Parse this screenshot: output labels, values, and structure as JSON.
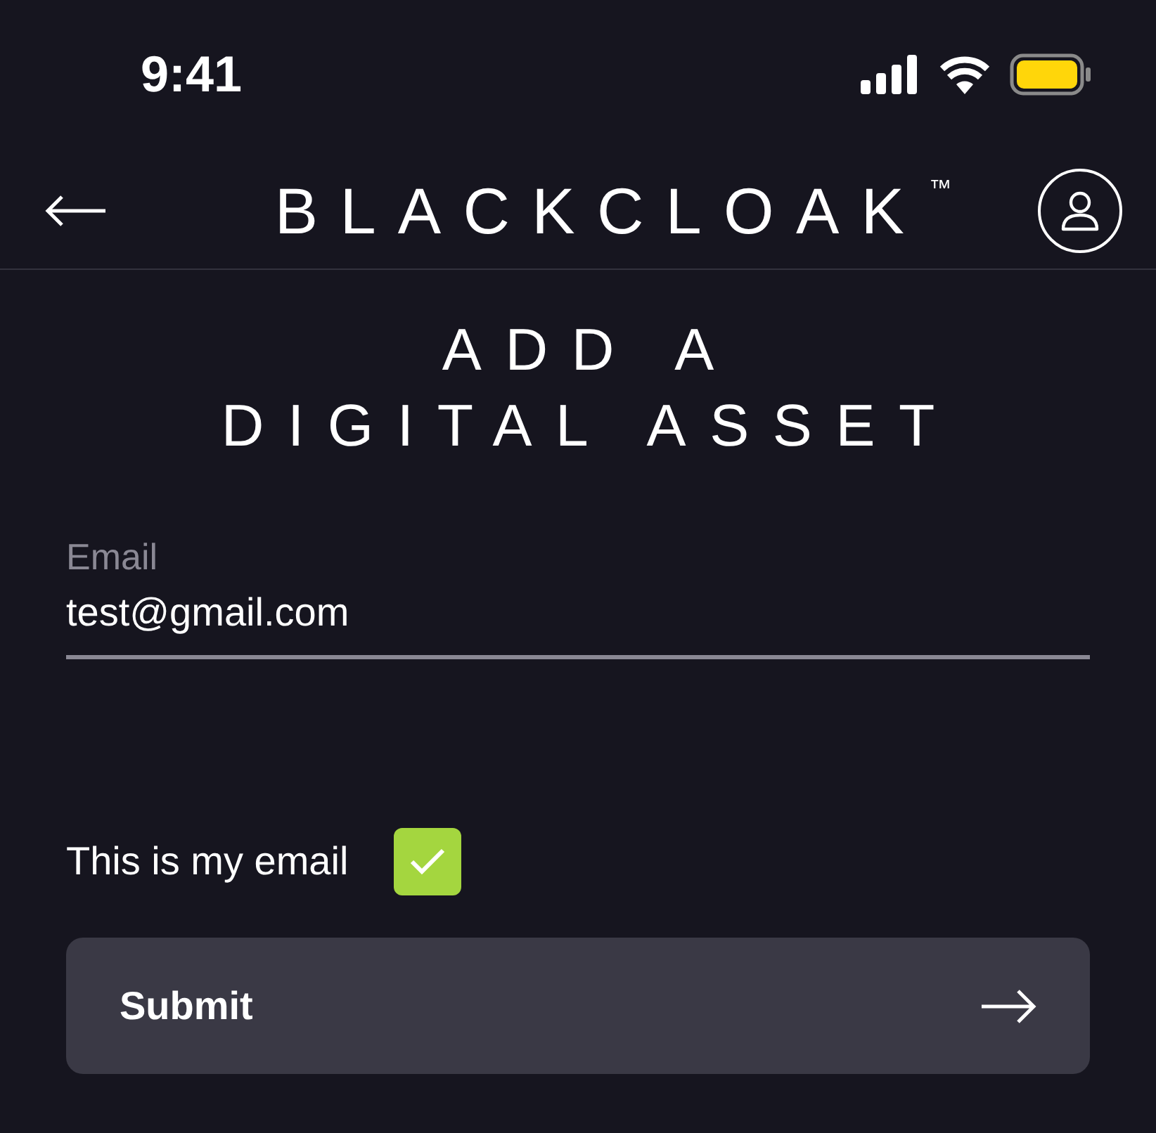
{
  "status_bar": {
    "time": "9:41"
  },
  "header": {
    "brand": "BLACKCLOAK",
    "trademark": "™"
  },
  "title_lines": [
    "ADD A",
    "DIGITAL ASSET"
  ],
  "email_field": {
    "label": "Email",
    "value": "test@gmail.com"
  },
  "confirm": {
    "label": "This is my email",
    "checked": true
  },
  "submit": {
    "label": "Submit"
  }
}
